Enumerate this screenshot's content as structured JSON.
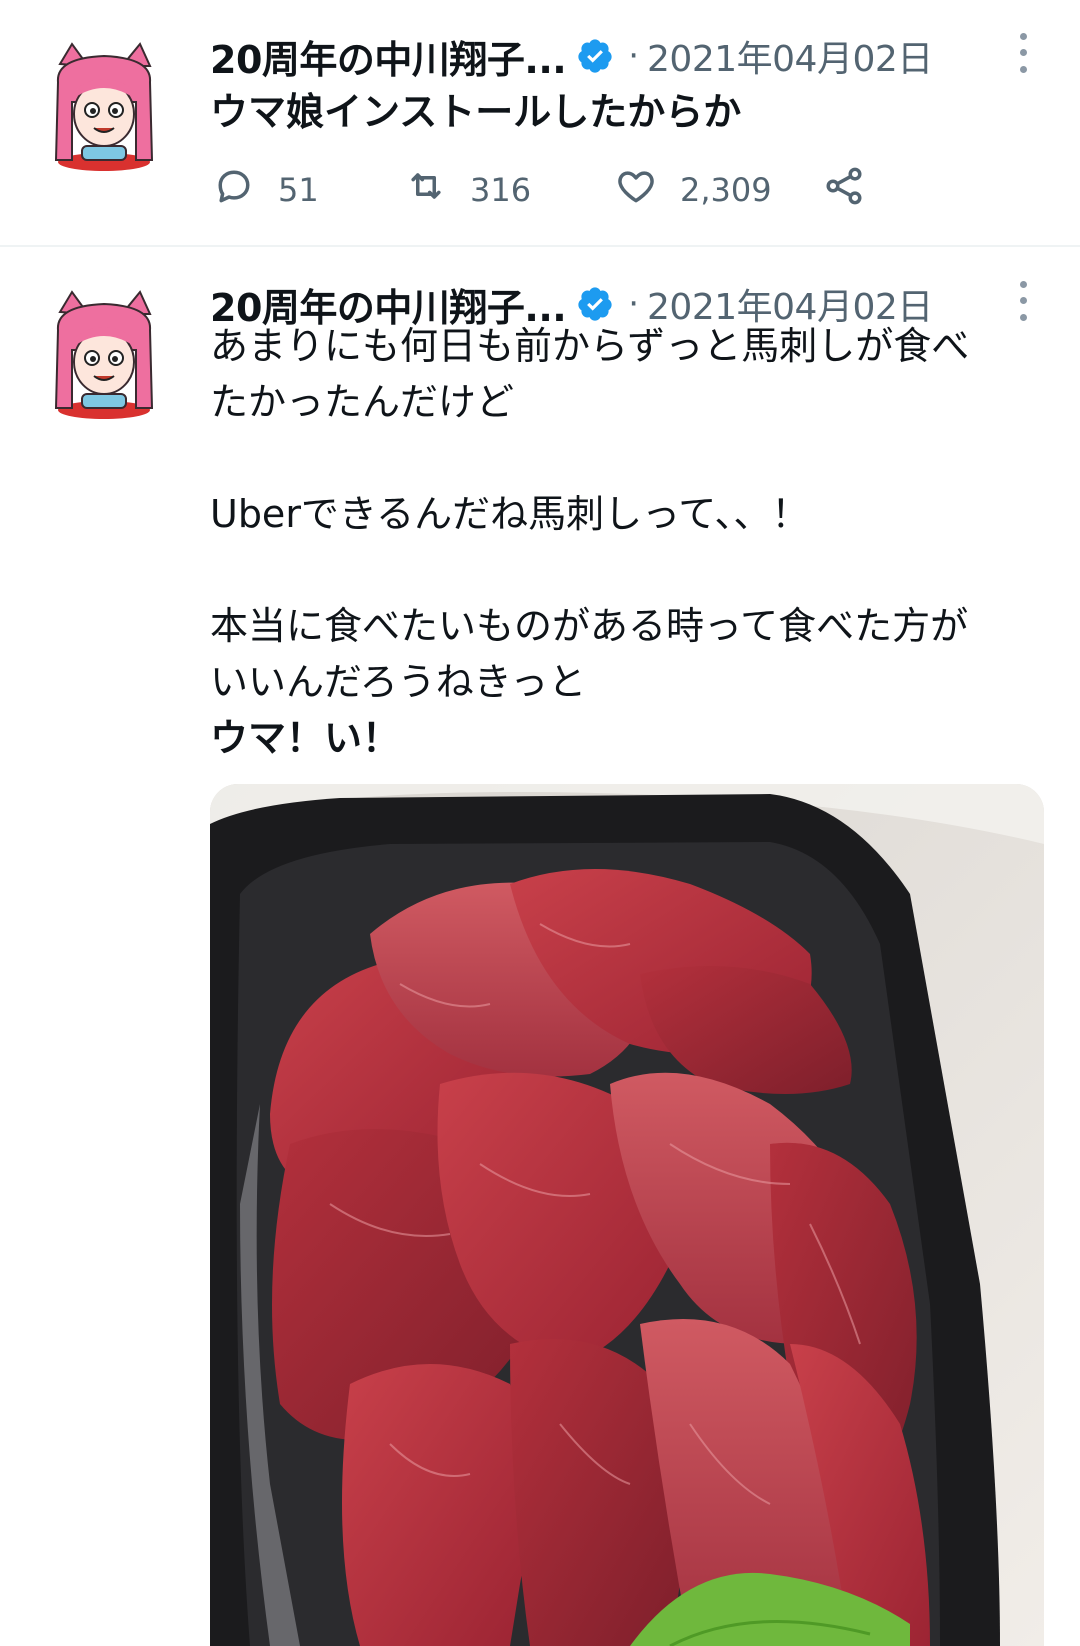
{
  "tweets": [
    {
      "author_name": "20周年の中川翔子...",
      "separator": "·",
      "date": "2021年04月02日",
      "lines": [
        "ウマ娘インストールしたからか"
      ],
      "replies": "51",
      "retweets": "316",
      "likes": "2,309"
    },
    {
      "author_name": "20周年の中川翔子...",
      "separator": "·",
      "date": "2021年04月02日",
      "lines": [
        "あまりにも何日も前からずっと馬刺しが食べ",
        "たかったんだけど",
        "",
        "Uberできるんだね馬刺しって、、！",
        "",
        "本当に食べたいものがある時って食べた方が",
        "いいんだろうねきっと",
        "ウマ！い！"
      ]
    }
  ],
  "icons": {
    "verified": "verified-badge-icon",
    "more": "more-options-icon",
    "reply": "reply-icon",
    "retweet": "retweet-icon",
    "like": "like-icon",
    "share": "share-icon"
  },
  "colors": {
    "verified_blue": "#1d9bf0",
    "secondary_text": "#536471",
    "divider": "#eff3f4",
    "avatar_hair": "#ee6f9f"
  }
}
